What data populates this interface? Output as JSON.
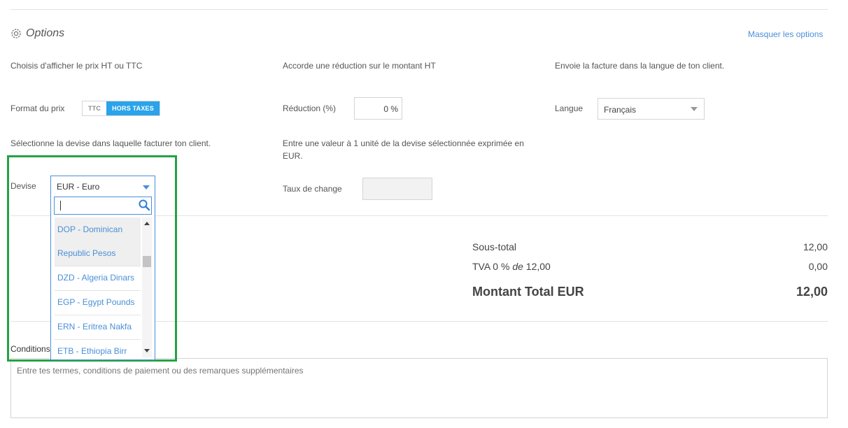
{
  "options": {
    "title": "Options",
    "hide_link": "Masquer les options"
  },
  "price": {
    "description": "Choisis d'afficher le prix HT ou TTC",
    "label": "Format du prix",
    "ttc": "TTC",
    "ht": "HORS TAXES"
  },
  "discount": {
    "description": "Accorde une réduction sur le montant HT",
    "label": "Réduction (%)",
    "value": "0 %"
  },
  "language": {
    "description": "Envoie la facture dans la langue de ton client.",
    "label": "Langue",
    "value": "Français"
  },
  "currency": {
    "description": "Sélectionne la devise dans laquelle facturer ton client.",
    "label": "Devise",
    "value": "EUR - Euro",
    "search_value": "",
    "options": [
      {
        "line1": "DOP - Dominican",
        "line2": "Republic Pesos"
      },
      {
        "line1": "DZD - Algeria Dinars"
      },
      {
        "line1": "EGP - Egypt Pounds"
      },
      {
        "line1": "ERN - Eritrea Nakfa"
      },
      {
        "line1": "ETB - Ethiopia Birr"
      }
    ]
  },
  "exchange": {
    "description_1": "Entre une valeur à 1 unité de la devise sélectionnée exprimée en",
    "description_2": "EUR.",
    "label": "Taux de change",
    "value": ""
  },
  "summary": {
    "subtotal_label": "Sous-total",
    "subtotal_value": "12,00",
    "tva_label_pre": "TVA 0 % ",
    "tva_label_de": "de",
    "tva_label_post": " 12,00",
    "tva_value": "0,00",
    "total_label": "Montant Total EUR",
    "total_value": "12,00"
  },
  "conditions": {
    "label": "Conditions",
    "placeholder": "Entre tes termes, conditions de paiement ou des remarques supplémentaires"
  },
  "colors": {
    "accent": "#2aa3ea",
    "link": "#4a8fd8",
    "highlight_border": "#25a244"
  }
}
